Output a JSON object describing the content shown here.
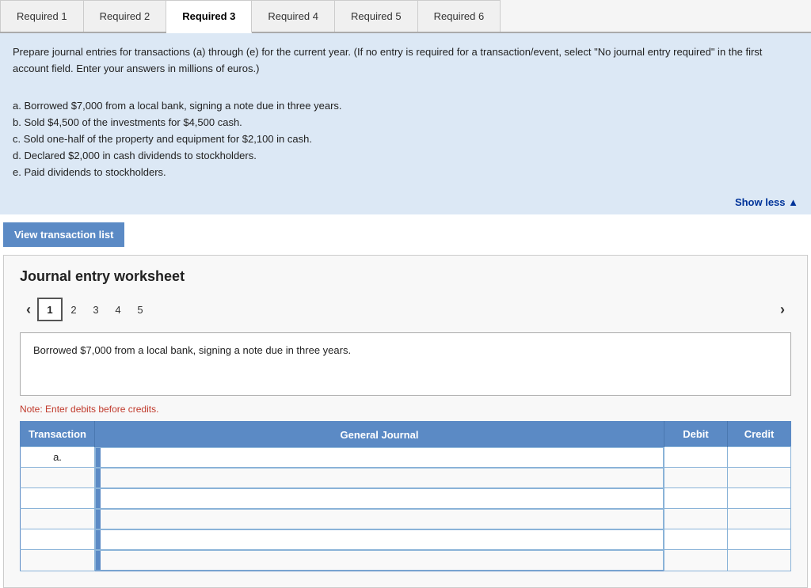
{
  "tabs": [
    {
      "id": "req1",
      "label": "Required 1",
      "active": false
    },
    {
      "id": "req2",
      "label": "Required 2",
      "active": false
    },
    {
      "id": "req3",
      "label": "Required 3",
      "active": true
    },
    {
      "id": "req4",
      "label": "Required 4",
      "active": false
    },
    {
      "id": "req5",
      "label": "Required 5",
      "active": false
    },
    {
      "id": "req6",
      "label": "Required 6",
      "active": false
    }
  ],
  "instructions": {
    "intro": "Prepare journal entries for transactions (a) through (e) for the current year. (If no entry is required for a transaction/event, select \"No journal entry required\" in the first account field. Enter your answers in millions of euros.)",
    "items": [
      "a. Borrowed $7,000 from a local bank, signing a note due in three years.",
      "b. Sold $4,500 of the investments for $4,500 cash.",
      "c. Sold one-half of the property and equipment for $2,100 in cash.",
      "d. Declared $2,000 in cash dividends to stockholders.",
      "e. Paid dividends to stockholders."
    ],
    "show_less": "Show less ▲"
  },
  "view_transaction_btn": "View transaction list",
  "worksheet": {
    "title": "Journal entry worksheet",
    "pages": [
      "1",
      "2",
      "3",
      "4",
      "5"
    ],
    "active_page": "1",
    "description": "Borrowed $7,000 from a local bank, signing a note due in three years.",
    "note": "Note: Enter debits before credits.",
    "table": {
      "headers": [
        "Transaction",
        "General Journal",
        "Debit",
        "Credit"
      ],
      "rows": [
        {
          "transaction": "a.",
          "journal": "",
          "debit": "",
          "credit": ""
        },
        {
          "transaction": "",
          "journal": "",
          "debit": "",
          "credit": ""
        },
        {
          "transaction": "",
          "journal": "",
          "debit": "",
          "credit": ""
        },
        {
          "transaction": "",
          "journal": "",
          "debit": "",
          "credit": ""
        },
        {
          "transaction": "",
          "journal": "",
          "debit": "",
          "credit": ""
        },
        {
          "transaction": "",
          "journal": "",
          "debit": "",
          "credit": ""
        }
      ]
    }
  }
}
